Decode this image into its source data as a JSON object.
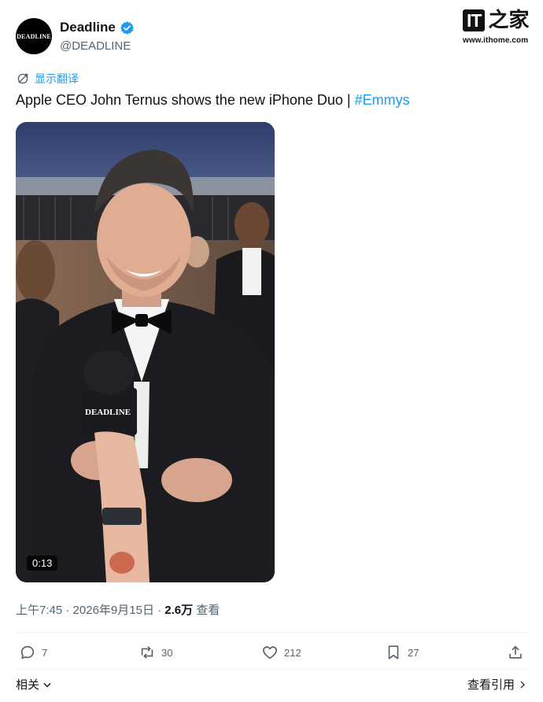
{
  "author": {
    "display_name": "Deadline",
    "handle": "@DEADLINE",
    "avatar_text": "DEADLINE",
    "verified": true
  },
  "watermark": {
    "logo_text": "IT",
    "logo_glyph": "之家",
    "url": "www.ithome.com"
  },
  "translate_label": "显示翻译",
  "tweet": {
    "text": "Apple CEO John Ternus shows the new iPhone Duo | ",
    "hashtag": "#Emmys"
  },
  "media": {
    "type": "video",
    "duration": "0:13",
    "mic_flag_text": "DEADLINE"
  },
  "meta": {
    "time": "上午7:45",
    "separator": "·",
    "date": "2026年9月15日",
    "views_count": "2.6万",
    "views_label": "查看"
  },
  "actions": {
    "replies": "7",
    "reposts": "30",
    "likes": "212",
    "bookmarks": "27"
  },
  "footer": {
    "related_label": "相关",
    "quotes_label": "查看引用"
  },
  "colors": {
    "accent": "#1d9bf0",
    "text": "#0f1419",
    "secondary": "#536471"
  }
}
